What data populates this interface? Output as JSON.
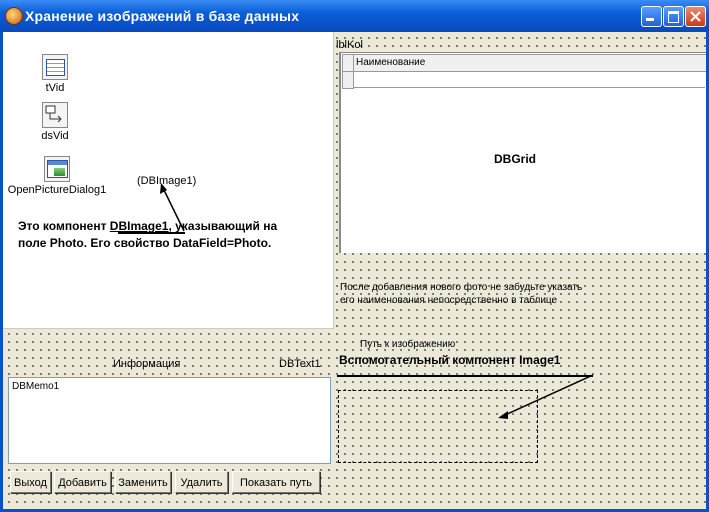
{
  "window": {
    "title": "Хранение изображений в базе данных",
    "accent": "#0a50c8",
    "controls": [
      "minimize-icon",
      "maximize-icon",
      "close-icon"
    ]
  },
  "components": [
    {
      "label": "tVid",
      "icon": "table-icon"
    },
    {
      "label": "dsVid",
      "icon": "datasource-icon"
    },
    {
      "label": "OpenPictureDialog1",
      "icon": "open-picture-dialog-icon"
    }
  ],
  "dbimage": {
    "label": "(DBImage1)",
    "note_prefix": "Это компонент ",
    "note_highlight": "DBImage1",
    "note_rest": ", указывающий на",
    "note_line2": "поле Photo. Его свойство  DataField=Photo."
  },
  "grid": {
    "lbl": "lblKol",
    "column_header": "Наименование",
    "caption": "DBGrid"
  },
  "hint": {
    "line1": "После добавления нового фото не забудьте  указать",
    "line2": "его наименования непосредственно в таблице"
  },
  "image1": {
    "path_label": "Путь к  изображению",
    "title": "Вспомогательный компонент Image1"
  },
  "info": {
    "label": "Информация",
    "dbtext": "DBText1",
    "memo": "DBMemo1"
  },
  "buttons": {
    "exit": "Выход",
    "add": "Добавить",
    "replace": "Заменить",
    "delete": "Удалить",
    "show_path": "Показать путь"
  }
}
